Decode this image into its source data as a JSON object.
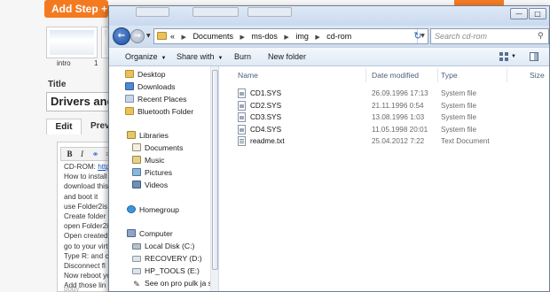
{
  "background_page": {
    "add_step_label": "Add Step +",
    "thumbnails": [
      {
        "label": "intro"
      },
      {
        "label": "1"
      }
    ],
    "title_label": "Title",
    "title_value": "Drivers and",
    "tabs": [
      "Edit",
      "Previ"
    ],
    "toolbar": [
      "B",
      "I"
    ],
    "editor_lines": [
      {
        "text": "CD-ROM: ",
        "link": "http"
      },
      {
        "text": "How to install"
      },
      {
        "text": "download this"
      },
      {
        "text": "and boot it"
      },
      {
        "text": "use Folder2is"
      },
      {
        "text": "Create folder"
      },
      {
        "text": "open Folder2i"
      },
      {
        "text": "Open created"
      },
      {
        "text": "go to your virt"
      },
      {
        "text": "Type R: and c"
      },
      {
        "text": "Disconnect fl"
      },
      {
        "text": "Now reboot yo"
      },
      {
        "text": "Add those lin"
      }
    ],
    "editor_footer": "body"
  },
  "explorer": {
    "address": {
      "crumbs": [
        "Documents",
        "ms-dos",
        "img",
        "cd-rom"
      ],
      "overflow": "«"
    },
    "search_placeholder": "Search cd-rom",
    "commands": {
      "organize": "Organize",
      "share_with": "Share with",
      "burn": "Burn",
      "new_folder": "New folder"
    },
    "nav": {
      "favorites": [
        "Desktop",
        "Downloads",
        "Recent Places",
        "Bluetooth Folder"
      ],
      "libraries_header": "Libraries",
      "libraries": [
        "Documents",
        "Music",
        "Pictures",
        "Videos"
      ],
      "homegroup": "Homegroup",
      "computer_header": "Computer",
      "drives": [
        "Local Disk (C:)",
        "RECOVERY (D:)",
        "HP_TOOLS (E:)"
      ],
      "network_item": "See on pro pulk ja see e"
    },
    "columns": [
      "Name",
      "Date modified",
      "Type",
      "Size"
    ],
    "files": [
      {
        "name": "CD1.SYS",
        "date": "26.09.1996 17:13",
        "type": "System file",
        "icon": "sys-file-icon"
      },
      {
        "name": "CD2.SYS",
        "date": "21.11.1996 0:54",
        "type": "System file",
        "icon": "sys-file-icon"
      },
      {
        "name": "CD3.SYS",
        "date": "13.08.1996 1:03",
        "type": "System file",
        "icon": "sys-file-icon"
      },
      {
        "name": "CD4.SYS",
        "date": "11.05.1998 20:01",
        "type": "System file",
        "icon": "sys-file-icon"
      },
      {
        "name": "readme.txt",
        "date": "25.04.2012 7:22",
        "type": "Text Document",
        "icon": "text-file-icon"
      }
    ]
  },
  "colors": {
    "accent_orange": "#f47a20",
    "window_border": "#6d7f96",
    "link_blue": "#1a56c8"
  }
}
